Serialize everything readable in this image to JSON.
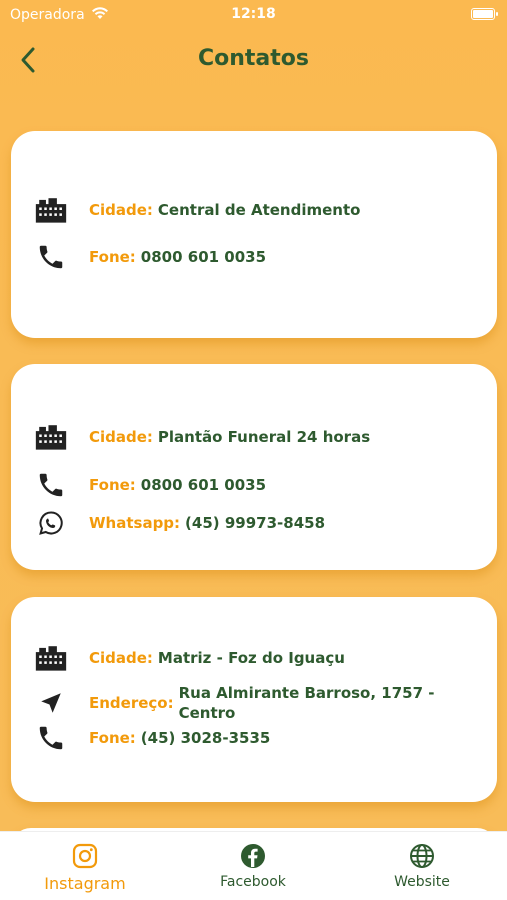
{
  "status": {
    "carrier": "Operadora",
    "time": "12:18"
  },
  "nav": {
    "title": "Contatos"
  },
  "cards": [
    {
      "city_label": "Cidade:",
      "city": "Central de Atendimento",
      "phone_label": "Fone:",
      "phone": "0800 601 0035"
    },
    {
      "city_label": "Cidade:",
      "city": "Plantão Funeral 24 horas",
      "phone_label": "Fone:",
      "phone": "0800 601 0035",
      "whatsapp_label": "Whatsapp:",
      "whatsapp": "(45) 99973-8458"
    },
    {
      "city_label": "Cidade:",
      "city": "Matriz - Foz do Iguaçu",
      "address_label": "Endereço:",
      "address": "Rua Almirante Barroso, 1757 - Centro",
      "phone_label": "Fone:",
      "phone": "(45) 3028-3535"
    }
  ],
  "tabs": [
    {
      "label": "Instagram",
      "icon": "instagram-icon",
      "active": true
    },
    {
      "label": "Facebook",
      "icon": "facebook-icon",
      "active": false
    },
    {
      "label": "Website",
      "icon": "globe-icon",
      "active": false
    }
  ],
  "colors": {
    "accent": "#f29a0b",
    "text": "#2e5a2f",
    "background": "#fbb950"
  }
}
